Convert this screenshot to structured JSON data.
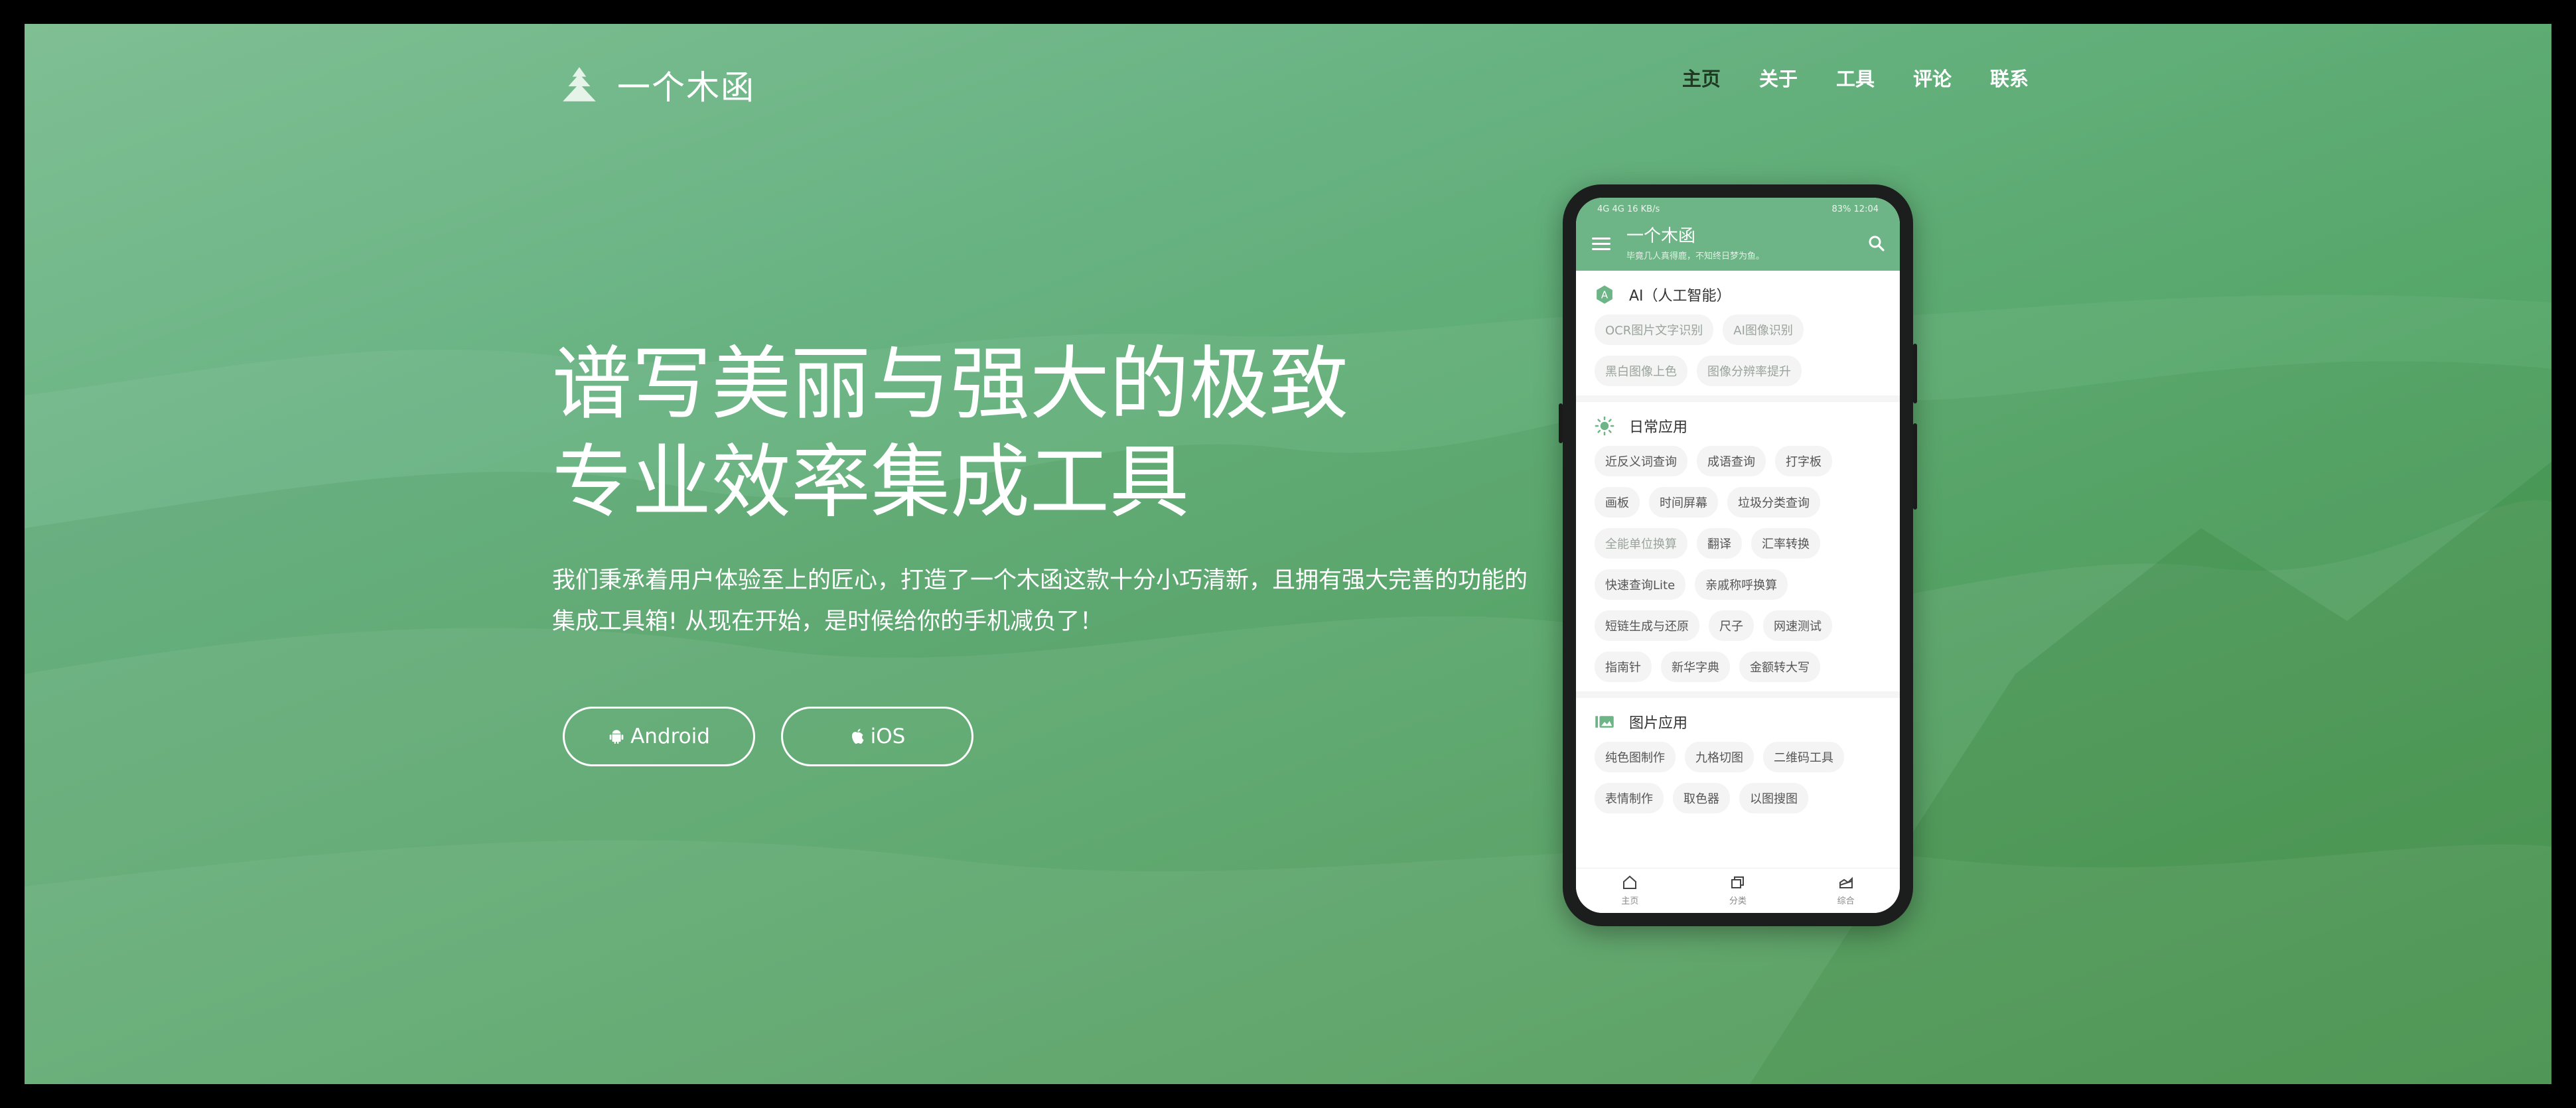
{
  "brand": {
    "name": "一个木函"
  },
  "nav": {
    "items": [
      "主页",
      "关于",
      "工具",
      "评论",
      "联系"
    ],
    "active_index": 0
  },
  "hero": {
    "title_line1": "谱写美丽与强大的极致",
    "title_line2": "专业效率集成工具",
    "description": "我们秉承着用户体验至上的匠心，打造了一个木函这款十分小巧清新，且拥有强大完善的功能的集成工具箱! 从现在开始，是时候给你的手机减负了！",
    "buttons": {
      "android": "Android",
      "ios": "iOS"
    }
  },
  "phone": {
    "status": {
      "left": "4G 4G 16 KB/s",
      "right": "83% 12:04"
    },
    "app_title": "一个木函",
    "app_subtitle": "毕竟几人真得鹿，不知终日梦为鱼。",
    "sections": [
      {
        "title": "AI（人工智能）",
        "icon": "ai-icon",
        "chips": [
          "OCR图片文字识别",
          "AI图像识别",
          "黑白图像上色",
          "图像分辨率提升"
        ],
        "dim": true
      },
      {
        "title": "日常应用",
        "icon": "sun-icon",
        "chips": [
          "近反义词查询",
          "成语查询",
          "打字板",
          "画板",
          "时间屏幕",
          "垃圾分类查询",
          "全能单位换算",
          "翻译",
          "汇率转换",
          "快速查询Lite",
          "亲戚称呼换算",
          "短链生成与还原",
          "尺子",
          "网速测试",
          "指南针",
          "新华字典",
          "金额转大写"
        ],
        "dim_indices": [
          6
        ]
      },
      {
        "title": "图片应用",
        "icon": "image-icon",
        "chips": [
          "纯色图制作",
          "九格切图",
          "二维码工具",
          "表情制作",
          "取色器",
          "以图搜图"
        ]
      }
    ],
    "tabs": [
      "主页",
      "分类",
      "综合"
    ]
  },
  "colors": {
    "accent": "#6db586",
    "bg_start": "#7fbf93",
    "bg_end": "#3f9145"
  }
}
